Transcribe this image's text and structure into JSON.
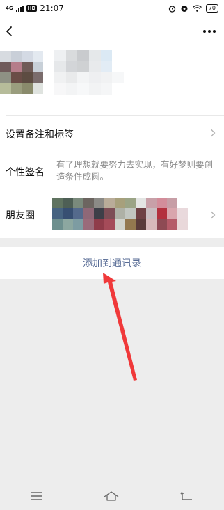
{
  "status_bar": {
    "network": "4G",
    "hd": "HD",
    "time": "21:07",
    "battery": "70"
  },
  "profile": {
    "remark_tags_label": "设置备注和标签",
    "signature_label": "个性签名",
    "signature_text": "有了理想就要努力去实现，有好梦则要创造条件成圆。",
    "moments_label": "朋友圈"
  },
  "actions": {
    "add_contact_label": "添加到通讯录"
  },
  "icons": {
    "back": "back-arrow-icon",
    "more": "more-dots-icon",
    "chevron": "chevron-right-icon",
    "alarm": "alarm-icon",
    "wifi": "wifi-icon",
    "menu": "menu-icon",
    "home": "home-icon",
    "return": "return-icon"
  },
  "colors": {
    "link": "#576b95",
    "annotation_arrow": "#f0393a",
    "background": "#ededed"
  }
}
